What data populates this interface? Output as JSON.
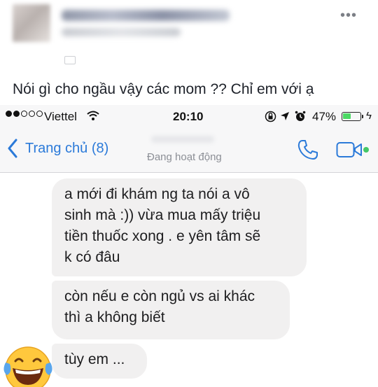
{
  "post": {
    "more_icon": "ellipsis-icon",
    "caption": "Nói gì cho ngầu vậy các mom ?? Chỉ em với ạ"
  },
  "status_bar": {
    "carrier": "Viettel",
    "time": "20:10",
    "battery_percent": "47%",
    "battery_level": 0.47,
    "battery_color": "#4cd964",
    "signal_dots_filled": 2,
    "signal_dots_total": 5
  },
  "nav_bar": {
    "back_label": "Trang chủ (8)",
    "contact_status": "Đang hoạt động",
    "accent_color": "#2b7ad9",
    "icons": [
      "chevron-left-icon",
      "phone-call-icon",
      "video-call-icon"
    ]
  },
  "messages": [
    {
      "lines": [
        "a mới đi khám ng ta nói a vô",
        "sinh mà :)) vừa mua mấy triệu",
        "tiền thuốc xong . e yên tâm sẽ",
        "k có đâu"
      ]
    },
    {
      "lines": [
        "còn nếu e còn ngủ vs ai khác",
        "thì a không biết"
      ]
    },
    {
      "lines": [
        "tùy em ..."
      ]
    }
  ],
  "bubble_color": "#f1f0f0",
  "emoji": "laughing-tears-emoji"
}
